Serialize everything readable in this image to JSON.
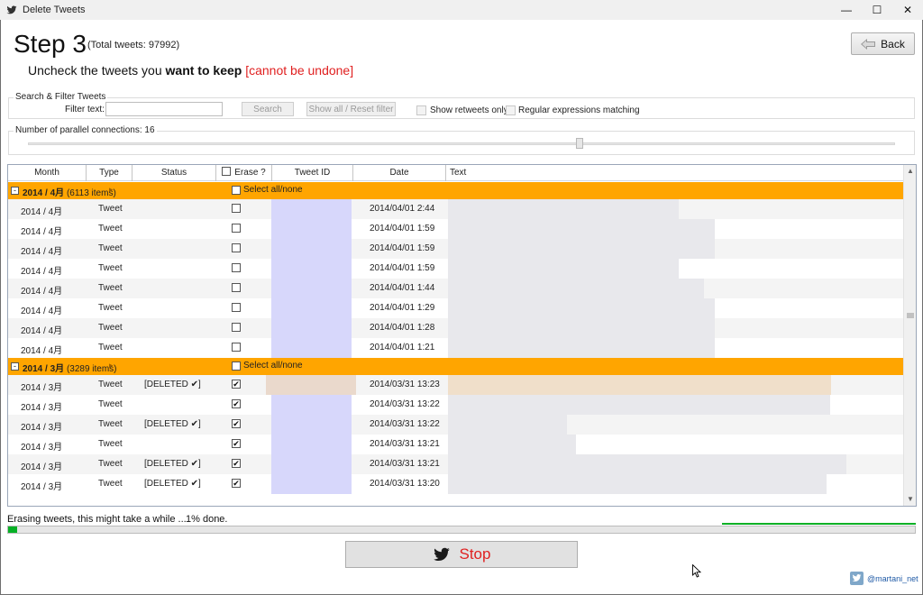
{
  "window": {
    "title": "Delete Tweets",
    "minimize_glyph": "—",
    "maximize_glyph": "☐",
    "close_glyph": "✕"
  },
  "header": {
    "step_title": "Step 3",
    "total_tweets": "(Total tweets: 97992)",
    "instruction_pre": "Uncheck the tweets you ",
    "instruction_bold": "want to keep",
    "instruction_warning": "[cannot be undone]",
    "back_label": "Back"
  },
  "filter": {
    "legend": "Search & Filter Tweets",
    "filter_label": "Filter text:",
    "filter_value": "",
    "search_label": "Search",
    "reset_label": "Show all / Reset filter",
    "retweets_label": "Show retweets only",
    "regex_label": "Regular expressions matching"
  },
  "connections": {
    "legend": "Number of parallel connections: 16",
    "value": 16
  },
  "grid": {
    "columns": {
      "month": "Month",
      "type": "Type",
      "status": "Status",
      "erase": "Erase ?",
      "tweet_id": "Tweet ID",
      "date": "Date",
      "text": "Text"
    },
    "groups": [
      {
        "name": "2014 / 4月",
        "count": "(6113 items)",
        "select_label": "Select all/none",
        "rows": [
          {
            "month": "2014 / 4月",
            "type": "Tweet",
            "status": "",
            "checked": false,
            "date": "2014/04/01 2:44"
          },
          {
            "month": "2014 / 4月",
            "type": "Tweet",
            "status": "",
            "checked": false,
            "date": "2014/04/01 1:59"
          },
          {
            "month": "2014 / 4月",
            "type": "Tweet",
            "status": "",
            "checked": false,
            "date": "2014/04/01 1:59"
          },
          {
            "month": "2014 / 4月",
            "type": "Tweet",
            "status": "",
            "checked": false,
            "date": "2014/04/01 1:59"
          },
          {
            "month": "2014 / 4月",
            "type": "Tweet",
            "status": "",
            "checked": false,
            "date": "2014/04/01 1:44"
          },
          {
            "month": "2014 / 4月",
            "type": "Tweet",
            "status": "",
            "checked": false,
            "date": "2014/04/01 1:29"
          },
          {
            "month": "2014 / 4月",
            "type": "Tweet",
            "status": "",
            "checked": false,
            "date": "2014/04/01 1:28"
          },
          {
            "month": "2014 / 4月",
            "type": "Tweet",
            "status": "",
            "checked": false,
            "date": "2014/04/01 1:21"
          }
        ]
      },
      {
        "name": "2014 / 3月",
        "count": "(3289 items)",
        "select_label": "Select all/none",
        "rows": [
          {
            "month": "2014 / 3月",
            "type": "Tweet",
            "status": "[DELETED ✔]",
            "checked": true,
            "date": "2014/03/31 13:23"
          },
          {
            "month": "2014 / 3月",
            "type": "Tweet",
            "status": "",
            "checked": true,
            "date": "2014/03/31 13:22"
          },
          {
            "month": "2014 / 3月",
            "type": "Tweet",
            "status": "[DELETED ✔]",
            "checked": true,
            "date": "2014/03/31 13:22"
          },
          {
            "month": "2014 / 3月",
            "type": "Tweet",
            "status": "",
            "checked": true,
            "date": "2014/03/31 13:21"
          },
          {
            "month": "2014 / 3月",
            "type": "Tweet",
            "status": "[DELETED ✔]",
            "checked": true,
            "date": "2014/03/31 13:21"
          },
          {
            "month": "2014 / 3月",
            "type": "Tweet",
            "status": "[DELETED ✔]",
            "checked": true,
            "date": "2014/03/31 13:20"
          }
        ]
      }
    ]
  },
  "progress": {
    "status_text": "Erasing tweets, this might take a while ...",
    "percent_text": "1% done.",
    "fraction": 0.01
  },
  "footer": {
    "stop_label": "Stop",
    "credit": "@martani_net"
  },
  "colors": {
    "group_header": "#ffa500",
    "warning": "#e02020",
    "progress": "#06b025",
    "link": "#1f5aa6"
  },
  "icons": {
    "app": "twitter-bird-icon",
    "back": "back-arrow-icon",
    "stop": "twitter-bird-icon",
    "credit": "twitter-badge-icon"
  }
}
